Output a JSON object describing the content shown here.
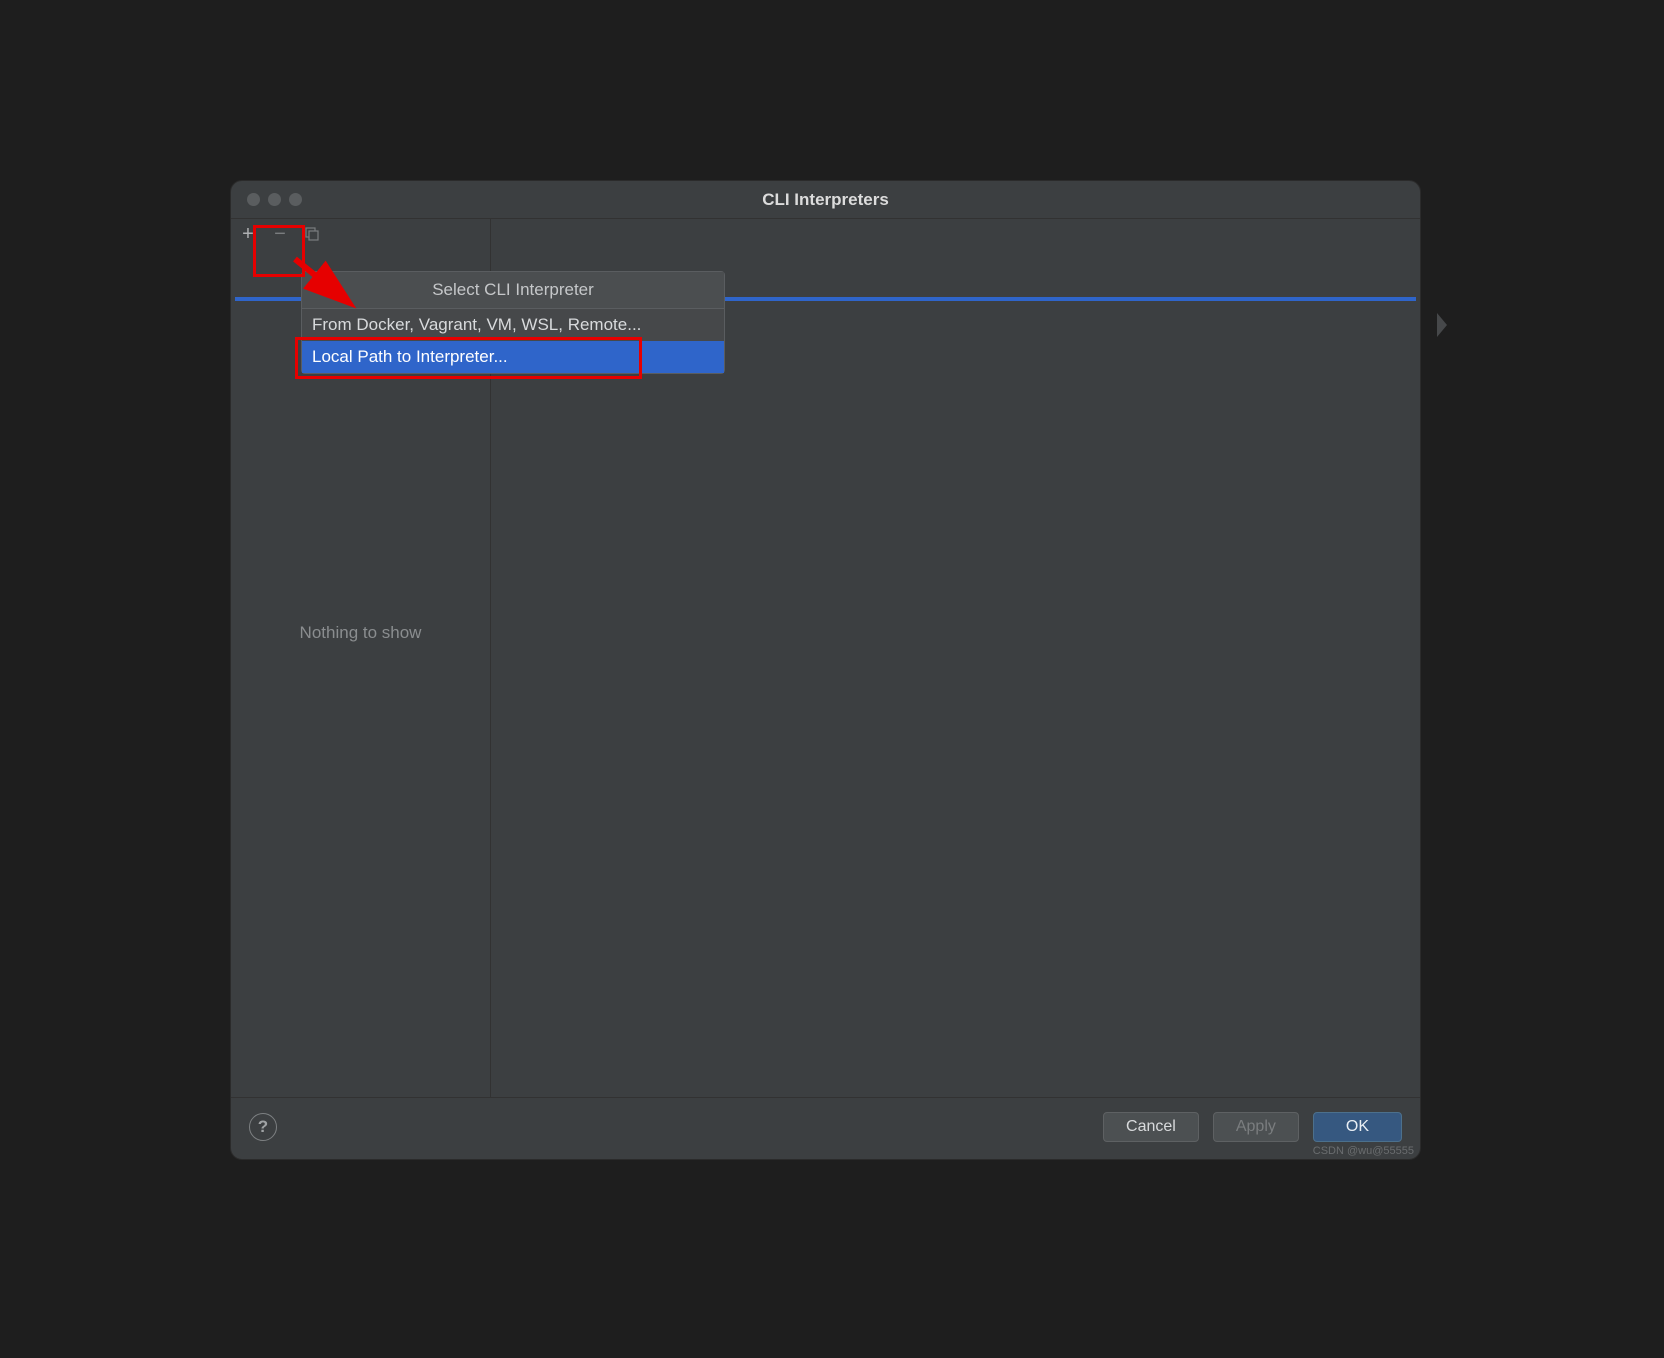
{
  "window": {
    "title": "CLI Interpreters"
  },
  "sidebar": {
    "empty_text": "Nothing to show"
  },
  "dropdown": {
    "title": "Select CLI Interpreter",
    "items": [
      {
        "label": "From Docker, Vagrant, VM, WSL, Remote...",
        "selected": false
      },
      {
        "label": "Local Path to Interpreter...",
        "selected": true
      }
    ]
  },
  "buttons": {
    "cancel": "Cancel",
    "apply": "Apply",
    "ok": "OK",
    "help": "?"
  },
  "watermark": "CSDN @wu@55555"
}
